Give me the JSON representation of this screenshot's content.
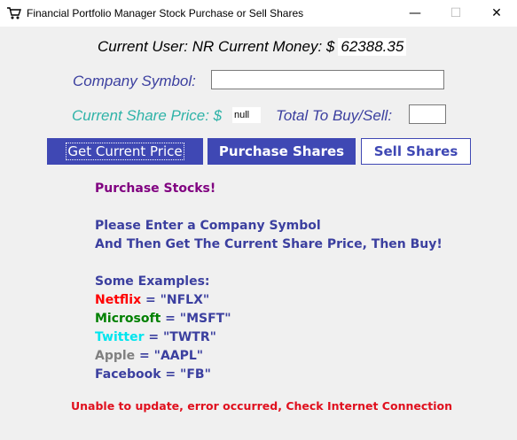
{
  "window": {
    "title": "Financial Portfolio Manager Stock Purchase or Sell Shares",
    "minimize_glyph": "—",
    "maximize_glyph": "☐",
    "close_glyph": "✕",
    "icon": "shopping-cart-icon"
  },
  "user": {
    "line": "Current User: NR Current Money: $",
    "money": "62388.35"
  },
  "symbol": {
    "label": "Company Symbol:",
    "value": ""
  },
  "price": {
    "label": "Current Share Price: $",
    "value": "null"
  },
  "total": {
    "label": "Total To Buy/Sell:",
    "value": ""
  },
  "buttons": {
    "get_price": "Get Current Price",
    "purchase": "Purchase Shares",
    "sell": "Sell Shares"
  },
  "info": {
    "heading": "Purchase Stocks!",
    "instruction_1": "Please Enter a Company Symbol",
    "instruction_2": "And Then Get The Current Share Price, Then Buy!",
    "examples_heading": "Some Examples:",
    "examples": [
      {
        "name": "Netflix",
        "rest": " = \"NFLX\"",
        "color": "#ff0000"
      },
      {
        "name": "Microsoft",
        "rest": " = \"MSFT\"",
        "color": "#008000"
      },
      {
        "name": "Twitter",
        "rest": " = \"TWTR\"",
        "color": "#00e5ee"
      },
      {
        "name": "Apple",
        "rest": " = \"AAPL\"",
        "color": "#808080"
      },
      {
        "name": "Facebook",
        "rest": " = \"FB\"",
        "color": "#3b3f9f"
      }
    ]
  },
  "error": "Unable to update, error occurred, Check Internet Connection",
  "colors": {
    "accent": "#3f48b4",
    "label_blue": "#3b3f9f",
    "label_teal": "#2fb3a8",
    "heading_purple": "#800080",
    "error_red": "#e0101e"
  }
}
